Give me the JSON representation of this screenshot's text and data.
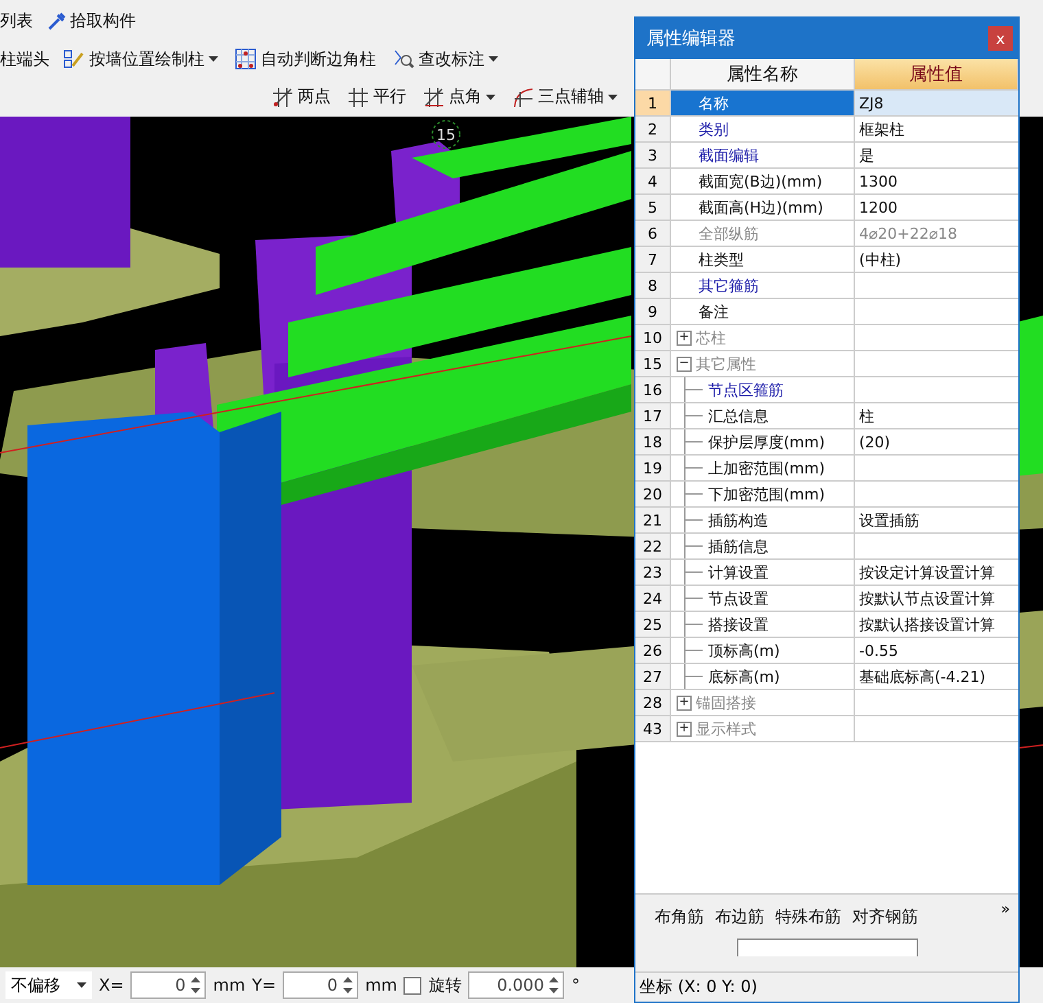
{
  "toolbar_rows": [
    {
      "items": [
        {
          "label": "列表",
          "kind": "text"
        },
        {
          "label": "拾取构件",
          "kind": "pick"
        }
      ]
    },
    {
      "items": [
        {
          "label": "柱端头",
          "kind": "text"
        },
        {
          "label": "按墙位置绘制柱",
          "kind": "wall",
          "dropdown": true
        },
        {
          "label": "自动判断边角柱",
          "kind": "grid"
        },
        {
          "label": "查改标注",
          "kind": "edit",
          "dropdown": true
        }
      ]
    },
    {
      "items": [
        {
          "label": "两点",
          "kind": "twopoint"
        },
        {
          "label": "平行",
          "kind": "parallel"
        },
        {
          "label": "点角",
          "kind": "angle",
          "dropdown": true
        },
        {
          "label": "三点辅轴",
          "kind": "arc",
          "dropdown": true
        }
      ]
    }
  ],
  "viewport": {
    "axis_label": "15"
  },
  "editor": {
    "title": "属性编辑器",
    "close": "x",
    "columns": [
      "属性名称",
      "属性值"
    ],
    "rows": [
      {
        "num": "1",
        "name": "名称",
        "value": "ZJ8",
        "kind": "plain",
        "selected": true
      },
      {
        "num": "2",
        "name": "类别",
        "value": "框架柱",
        "kind": "link",
        "selected": false
      },
      {
        "num": "3",
        "name": "截面编辑",
        "value": "是",
        "kind": "link",
        "selected": false
      },
      {
        "num": "4",
        "name": "截面宽(B边)(mm)",
        "value": "1300",
        "kind": "plain",
        "selected": false
      },
      {
        "num": "5",
        "name": "截面高(H边)(mm)",
        "value": "1200",
        "kind": "plain",
        "selected": false
      },
      {
        "num": "6",
        "name": "全部纵筋",
        "value": "4⌀20+22⌀18",
        "kind": "muted",
        "selected": false
      },
      {
        "num": "7",
        "name": "柱类型",
        "value": "(中柱)",
        "kind": "plain",
        "selected": false
      },
      {
        "num": "8",
        "name": "其它箍筋",
        "kind": "link",
        "selected": false
      },
      {
        "num": "9",
        "name": "备注",
        "kind": "plain",
        "selected": false
      },
      {
        "num": "10",
        "name": "芯柱",
        "kind": "muted",
        "selected": false,
        "toggle": "+"
      },
      {
        "num": "15",
        "name": "其它属性",
        "kind": "muted",
        "selected": false,
        "toggle": "−",
        "children": [
          {
            "num": "16",
            "name": "节点区箍筋",
            "kind": "link",
            "selected": false
          },
          {
            "num": "17",
            "name": "汇总信息",
            "value": "柱",
            "kind": "plain",
            "selected": false
          },
          {
            "num": "18",
            "name": "保护层厚度(mm)",
            "value": "(20)",
            "kind": "plain",
            "selected": false
          },
          {
            "num": "19",
            "name": "上加密范围(mm)",
            "kind": "plain",
            "selected": false
          },
          {
            "num": "20",
            "name": "下加密范围(mm)",
            "kind": "plain",
            "selected": false
          },
          {
            "num": "21",
            "name": "插筋构造",
            "value": "设置插筋",
            "kind": "plain",
            "selected": false
          },
          {
            "num": "22",
            "name": "插筋信息",
            "kind": "plain",
            "selected": false
          },
          {
            "num": "23",
            "name": "计算设置",
            "value": "按设定计算设置计算",
            "kind": "plain",
            "selected": false
          },
          {
            "num": "24",
            "name": "节点设置",
            "value": "按默认节点设置计算",
            "kind": "plain",
            "selected": false
          },
          {
            "num": "25",
            "name": "搭接设置",
            "value": "按默认搭接设置计算",
            "kind": "plain",
            "selected": false
          },
          {
            "num": "26",
            "name": "顶标高(m)",
            "value": "-0.55",
            "kind": "plain",
            "selected": false
          },
          {
            "num": "27",
            "name": "底标高(m)",
            "value": "基础底标高(-4.21)",
            "kind": "plain",
            "selected": false
          }
        ]
      },
      {
        "num": "28",
        "name": "锚固搭接",
        "kind": "muted",
        "selected": false,
        "toggle": "+"
      },
      {
        "num": "43",
        "name": "显示样式",
        "kind": "muted",
        "selected": false,
        "toggle": "+"
      }
    ],
    "tools": [
      "布角筋",
      "布边筋",
      "特殊布筋",
      "对齐钢筋"
    ],
    "more": "»",
    "status": "坐标 (X: 0 Y: 0)"
  },
  "bottom_bar": {
    "offset": "不偏移",
    "x_label": "X=",
    "x_value": "0",
    "x_unit": "mm",
    "y_label": "Y=",
    "y_value": "0",
    "y_unit": "mm",
    "rotate_checked": false,
    "rotate_label": "旋转",
    "rotate_value": "0.000",
    "degree": "°"
  }
}
